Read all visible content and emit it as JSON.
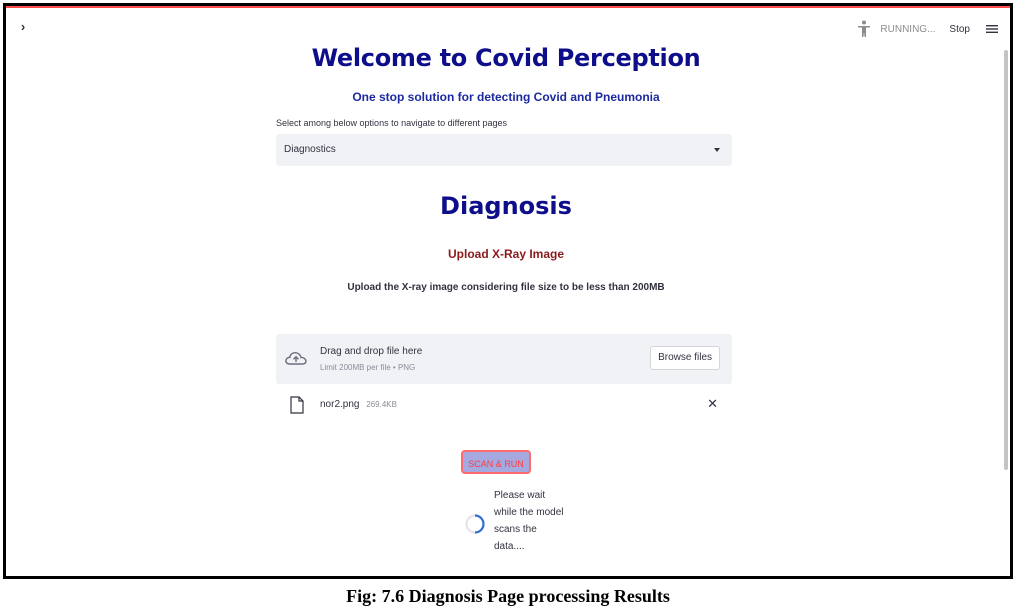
{
  "header": {
    "sidebar_toggle_glyph": "›",
    "status_text": "RUNNING...",
    "stop_label": "Stop",
    "menu_glyph": "≡",
    "running_icon": "running-person-icon",
    "menu_icon": "hamburger-menu-icon"
  },
  "page": {
    "title": "Welcome to Covid Perception",
    "subtitle": "One stop solution for detecting Covid and Pneumonia",
    "select_label": "Select among below options to navigate to different pages",
    "select_value": "Diagnostics"
  },
  "diagnosis": {
    "heading": "Diagnosis",
    "upload_title": "Upload X-Ray Image",
    "upload_description": "Upload the X-ray image considering file size to be less than 200MB"
  },
  "uploader": {
    "drag_text": "Drag and drop file here",
    "limit_text": "Limit 200MB per file • PNG",
    "browse_label": "Browse files",
    "file_name": "nor2.png",
    "file_size": "269.4KB",
    "remove_glyph": "✕"
  },
  "action": {
    "scan_label": "SCAN & RUN",
    "wait_message": "Please wait while the model scans the data...."
  },
  "caption": "Fig: 7.6 Diagnosis Page processing Results",
  "colors": {
    "heading": "#0e0e8b",
    "upload_title": "#8b1a1a",
    "scan_border": "#ff6b6b",
    "scan_fill": "#a6a8e0",
    "accent_line": "#ff4b4b"
  }
}
